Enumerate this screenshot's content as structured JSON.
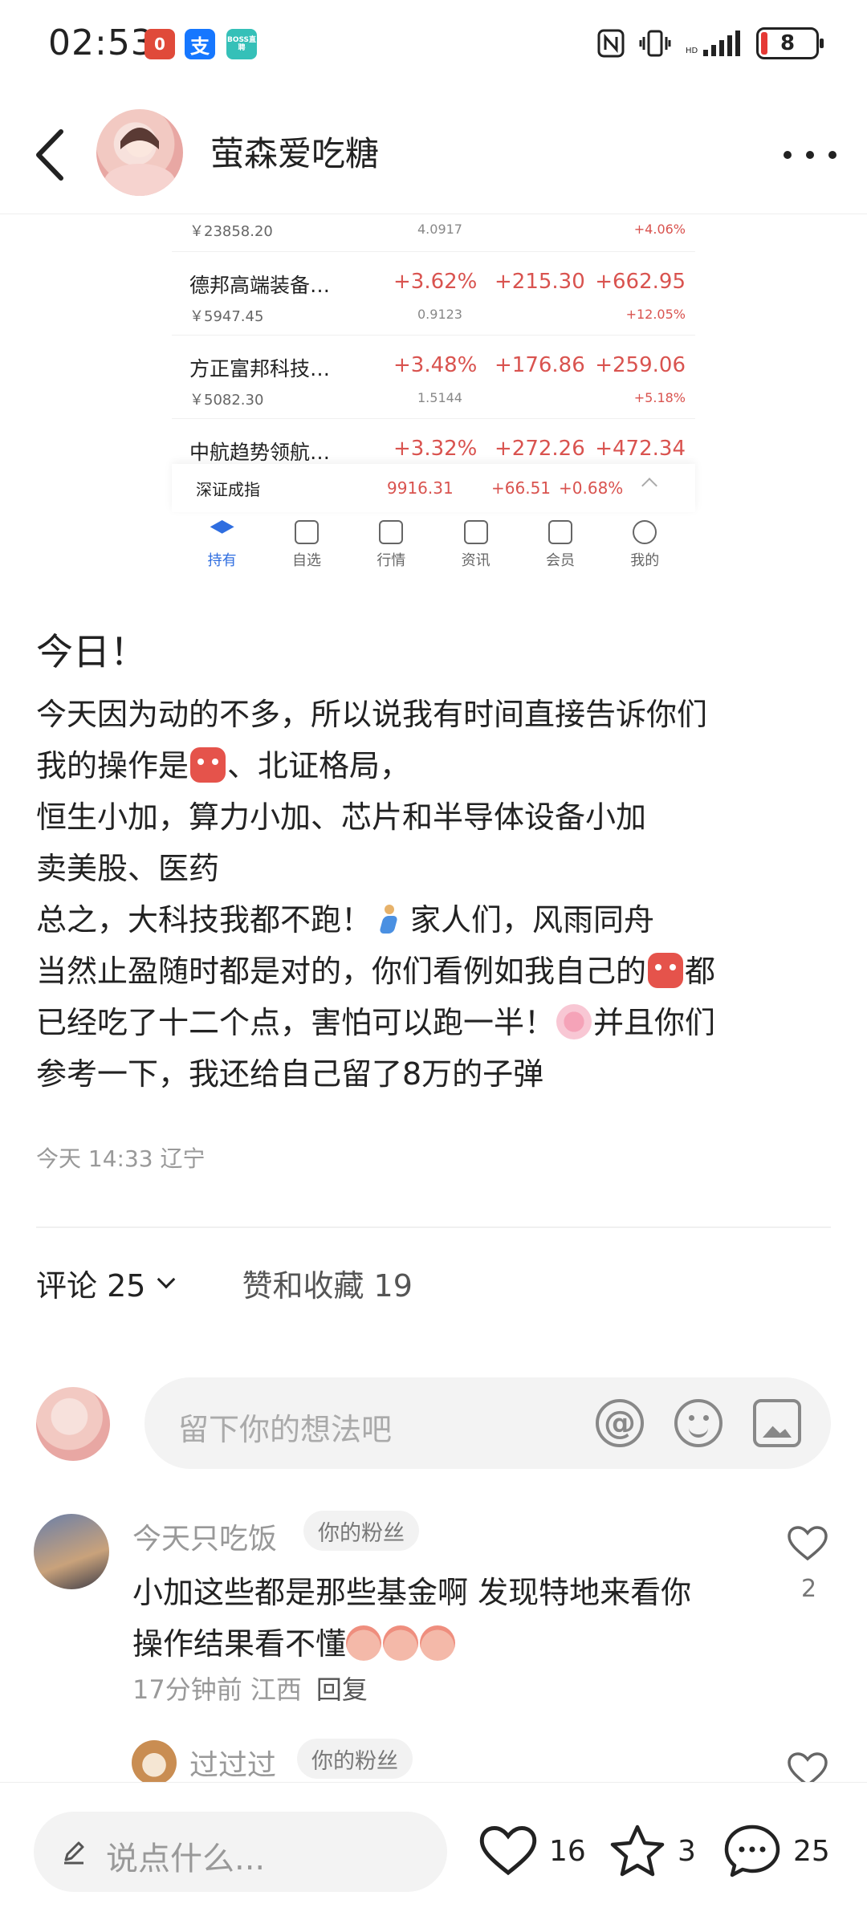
{
  "status_bar": {
    "time": "02:53",
    "apps": [
      "0",
      "支",
      "BOSS直聘"
    ],
    "battery": "8"
  },
  "header": {
    "author_name": "萤森爱吃糖"
  },
  "embedded_screenshot": {
    "top_partial": {
      "value": "￥23858.20",
      "sub": "4.0917",
      "total_pct": "+4.06%"
    },
    "funds": [
      {
        "name": "德邦高端装备…",
        "value": "￥5947.45",
        "pct": "+3.62%",
        "sub": "0.9123",
        "day": "+215.30",
        "total": "+662.95",
        "total_pct": "+12.05%"
      },
      {
        "name": "方正富邦科技…",
        "value": "￥5082.30",
        "pct": "+3.48%",
        "sub": "1.5144",
        "day": "+176.86",
        "total": "+259.06",
        "total_pct": "+5.18%"
      },
      {
        "name": "中航趋势领航…",
        "pct": "+3.32%",
        "day": "+272.26",
        "total": "+472.34"
      }
    ],
    "index": {
      "name": "深证成指",
      "value": "9916.31",
      "change": "+66.51",
      "pct": "+0.68%"
    },
    "tabs": [
      "持有",
      "自选",
      "行情",
      "资讯",
      "会员",
      "我的"
    ]
  },
  "post": {
    "title": "今日！",
    "lines": {
      "l1": "今天因为动的不多，所以说我有时间直接告诉你们",
      "l2a": "我的操作是",
      "l2b": "、北证格局，",
      "l3": "恒生小加，算力小加、芯片和半导体设备小加",
      "l4": "卖美股、医药",
      "l5a": "总之，大科技我都不跑！",
      "l5b": "家人们，风雨同舟",
      "l6a": "当然止盈随时都是对的，你们看例如我自己的",
      "l6b": "都",
      "l7a": "已经吃了十二个点，害怕可以跑一半！",
      "l7b": "并且你们",
      "l8": "参考一下，我还给自己留了8万的子弹"
    },
    "meta": "今天 14:33 辽宁"
  },
  "tabs": {
    "comments": "评论 25",
    "likes": "赞和收藏 19"
  },
  "comment_input": {
    "placeholder": "留下你的想法吧"
  },
  "comments": [
    {
      "name": "今天只吃饭",
      "badge": "你的粉丝",
      "text_l1": "小加这些都是那些基金啊 发现特地来看你",
      "text_l2": "操作结果看不懂",
      "meta": "17分钟前 江西",
      "reply": "回复",
      "likes": "2"
    },
    {
      "name": "过过过",
      "badge": "你的粉丝"
    }
  ],
  "bottom_bar": {
    "placeholder": "说点什么...",
    "likes": "16",
    "stars": "3",
    "comments": "25"
  },
  "colors": {
    "red": "#d9534f",
    "blue_tab": "#2f6ee0",
    "gray_text": "#999999"
  }
}
